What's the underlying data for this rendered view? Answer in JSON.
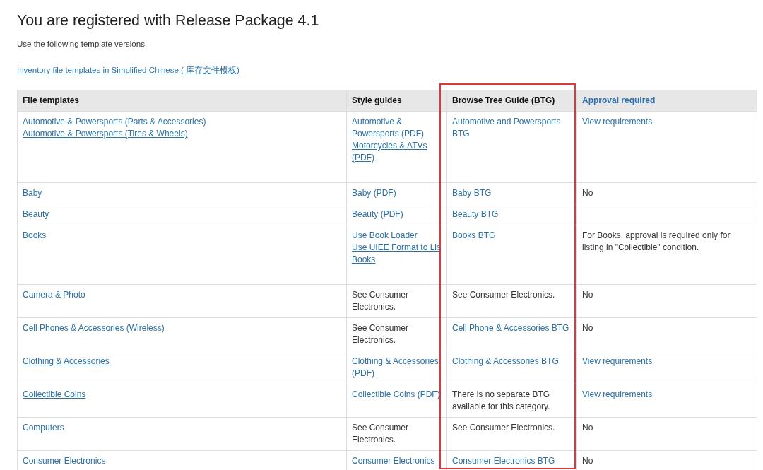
{
  "title": "You are registered with Release Package 4.1",
  "intro": "Use the following template versions.",
  "link": {
    "text": "Inventory file templates in Simplified Chinese ( 库存文件模板)",
    "underlined": true
  },
  "table": {
    "columns": [
      {
        "label": "File templates",
        "kind": "text",
        "highlighted": false
      },
      {
        "label": "Style guides",
        "kind": "text",
        "highlighted": false
      },
      {
        "label": "Browse Tree Guide (BTG)",
        "kind": "text",
        "highlighted": true
      },
      {
        "label": "Approval required",
        "kind": "link",
        "highlighted": false
      }
    ],
    "rows": [
      {
        "file_templates": [
          {
            "text": "Automotive & Powersports (Parts & Accessories)",
            "kind": "link",
            "underlined": false
          },
          {
            "text": "Automotive & Powersports (Tires & Wheels)",
            "kind": "link",
            "underlined": true
          }
        ],
        "style_guides": [
          {
            "text": "Automotive & Powersports (PDF)",
            "kind": "link",
            "underlined": false
          },
          {
            "text": "Motorcycles & ATVs (PDF)",
            "kind": "link",
            "underlined": true
          }
        ],
        "browse_tree_guide": [
          {
            "text": "Automotive and Powersports BTG",
            "kind": "link",
            "underlined": false
          }
        ],
        "approval_required": [
          {
            "text": "View requirements",
            "kind": "link",
            "underlined": false
          }
        ]
      },
      {
        "file_templates": [
          {
            "text": "Baby",
            "kind": "link",
            "underlined": false
          }
        ],
        "style_guides": [
          {
            "text": "Baby (PDF)",
            "kind": "link",
            "underlined": false
          }
        ],
        "browse_tree_guide": [
          {
            "text": "Baby BTG",
            "kind": "link",
            "underlined": false
          }
        ],
        "approval_required": [
          {
            "text": "No",
            "kind": "text",
            "underlined": false
          }
        ]
      },
      {
        "file_templates": [
          {
            "text": "Beauty",
            "kind": "link",
            "underlined": false
          }
        ],
        "style_guides": [
          {
            "text": "Beauty (PDF)",
            "kind": "link",
            "underlined": false
          }
        ],
        "browse_tree_guide": [
          {
            "text": "Beauty BTG",
            "kind": "link",
            "underlined": false
          }
        ]
      },
      {
        "file_templates": [
          {
            "text": "Books",
            "kind": "link",
            "underlined": false
          }
        ],
        "style_guides": [
          {
            "text": "Use Book Loader",
            "kind": "link",
            "underlined": false
          },
          {
            "text": "Use UIEE Format to Lis",
            "kind": "link",
            "underlined": true
          },
          {
            "text": "Books",
            "kind": "link",
            "underlined": true
          }
        ],
        "browse_tree_guide": [
          {
            "text": "Books BTG",
            "kind": "link",
            "underlined": false
          }
        ],
        "approval_required": [
          {
            "text": "For Books, approval is required only for listing in \"Collectible\" condition.",
            "kind": "text",
            "underlined": false
          }
        ]
      },
      {
        "file_templates": [
          {
            "text": "Camera & Photo",
            "kind": "link",
            "underlined": false
          }
        ],
        "style_guides": [
          {
            "text": "See Consumer Electronics.",
            "kind": "text",
            "underlined": false
          }
        ],
        "browse_tree_guide": [
          {
            "text": "See Consumer Electronics.",
            "kind": "text",
            "underlined": false
          }
        ],
        "approval_required": [
          {
            "text": "No",
            "kind": "text",
            "underlined": false
          }
        ]
      },
      {
        "file_templates": [
          {
            "text": "Cell Phones & Accessories (Wireless)",
            "kind": "link",
            "underlined": false
          }
        ],
        "style_guides": [
          {
            "text": "See Consumer Electronics.",
            "kind": "text",
            "underlined": false
          }
        ],
        "browse_tree_guide": [
          {
            "text": "Cell Phone & Accessories BTG",
            "kind": "link",
            "underlined": false
          }
        ],
        "approval_required": [
          {
            "text": "No",
            "kind": "text",
            "underlined": false
          }
        ]
      },
      {
        "file_templates": [
          {
            "text": "Clothing & Accessories",
            "kind": "link",
            "underlined": true
          }
        ],
        "style_guides": [
          {
            "text": "Clothing & Accessories (PDF)",
            "kind": "link",
            "underlined": false
          }
        ],
        "browse_tree_guide": [
          {
            "text": "Clothing & Accessories BTG",
            "kind": "link",
            "underlined": false
          }
        ],
        "approval_required": [
          {
            "text": "View requirements",
            "kind": "link",
            "underlined": false
          }
        ]
      },
      {
        "file_templates": [
          {
            "text": "Collectible Coins",
            "kind": "link",
            "underlined": true
          }
        ],
        "style_guides": [
          {
            "text": "Collectible Coins (PDF)",
            "kind": "link",
            "underlined": false
          }
        ],
        "browse_tree_guide": [
          {
            "text": "There is no separate BTG available for this category.",
            "kind": "text",
            "underlined": false
          }
        ],
        "approval_required": [
          {
            "text": "View requirements",
            "kind": "link",
            "underlined": false
          }
        ]
      },
      {
        "file_templates": [
          {
            "text": "Computers",
            "kind": "link",
            "underlined": false
          }
        ],
        "style_guides": [
          {
            "text": "See Consumer Electronics.",
            "kind": "text",
            "underlined": false
          }
        ],
        "browse_tree_guide": [
          {
            "text": "See Consumer Electronics.",
            "kind": "text",
            "underlined": false
          }
        ],
        "approval_required": [
          {
            "text": "No",
            "kind": "text",
            "underlined": false
          }
        ]
      },
      {
        "file_templates": [
          {
            "text": "Consumer Electronics",
            "kind": "link",
            "underlined": false
          }
        ],
        "style_guides": [
          {
            "text": "Consumer Electronics",
            "kind": "link",
            "underlined": false
          }
        ],
        "browse_tree_guide": [
          {
            "text": "Consumer Electronics BTG",
            "kind": "link",
            "underlined": false
          }
        ],
        "approval_required": [
          {
            "text": "No",
            "kind": "text",
            "underlined": false
          }
        ]
      }
    ]
  }
}
